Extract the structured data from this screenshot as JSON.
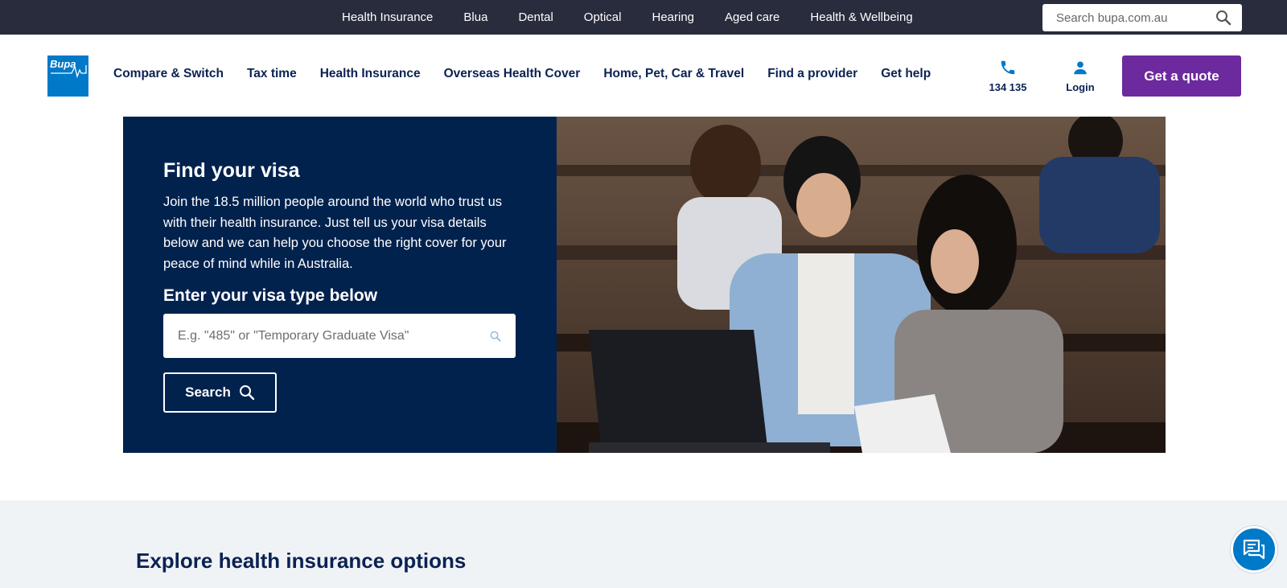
{
  "topbar": {
    "links": [
      "Health Insurance",
      "Blua",
      "Dental",
      "Optical",
      "Hearing",
      "Aged care",
      "Health & Wellbeing"
    ],
    "search_placeholder": "Search bupa.com.au"
  },
  "logo": {
    "text": "Bupa"
  },
  "nav": {
    "links": [
      "Compare & Switch",
      "Tax time",
      "Health Insurance",
      "Overseas Health Cover",
      "Home, Pet, Car & Travel",
      "Find a provider",
      "Get help"
    ],
    "phone_label": "134 135",
    "login_label": "Login",
    "quote_label": "Get a quote"
  },
  "hero": {
    "title": "Find your visa",
    "text": "Join the 18.5 million people around the world who trust us with their health insurance. Just tell us your visa details below and we can help you choose the right cover for your peace of mind while in Australia.",
    "subtitle": "Enter your visa type below",
    "input_placeholder": "E.g. \"485\" or \"Temporary Graduate Visa\"",
    "search_label": "Search"
  },
  "explore": {
    "title": "Explore health insurance options"
  },
  "colors": {
    "brand_blue": "#0079c8",
    "navy": "#02224e",
    "purple": "#6c2a9e",
    "topbar": "#282c3c"
  }
}
